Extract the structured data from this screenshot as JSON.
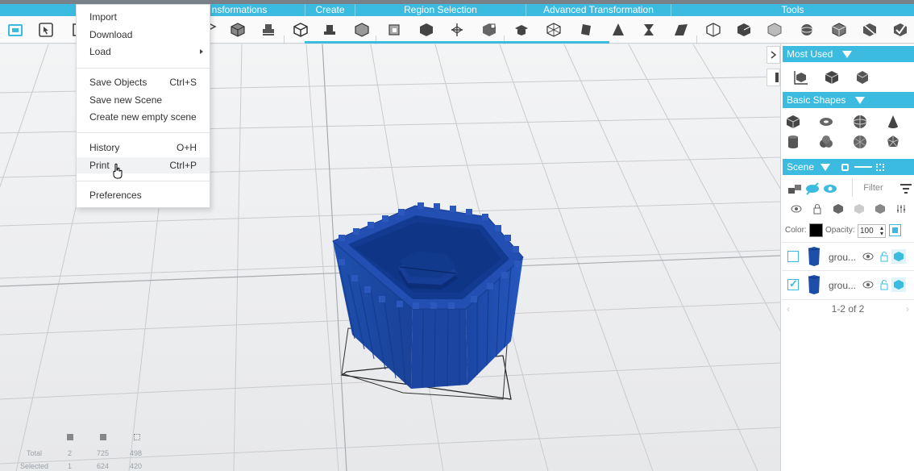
{
  "ribbon": {
    "categories": [
      {
        "label": "nsformations"
      },
      {
        "label": "Create"
      },
      {
        "label": "Region Selection"
      },
      {
        "label": "Advanced Transformation"
      },
      {
        "label": "Tools"
      }
    ]
  },
  "file_menu": {
    "items": [
      {
        "label": "Import",
        "shortcut": ""
      },
      {
        "label": "Download",
        "shortcut": ""
      },
      {
        "label": "Load",
        "shortcut": ""
      },
      {
        "label": "Save Objects",
        "shortcut": "Ctrl+S"
      },
      {
        "label": "Save new Scene",
        "shortcut": ""
      },
      {
        "label": "Create new empty scene",
        "shortcut": ""
      },
      {
        "label": "History",
        "shortcut": "O+H"
      },
      {
        "label": "Print",
        "shortcut": "Ctrl+P"
      },
      {
        "label": "Preferences",
        "shortcut": ""
      }
    ]
  },
  "right_panel": {
    "most_used_title": "Most Used",
    "basic_shapes_title": "Basic Shapes",
    "scene_title": "Scene",
    "filter_placeholder": "Filter",
    "color_label": "Color:",
    "opacity_label": "Opacity:",
    "opacity_value": "100",
    "color_value": "#000000",
    "objects": [
      {
        "name": "grou...",
        "checked": false
      },
      {
        "name": "grou...",
        "checked": true
      }
    ],
    "pager": "1-2 of 2"
  },
  "stats": {
    "total_label": "Total",
    "selected_label": "Selected",
    "total": [
      "2",
      "725",
      "498"
    ],
    "selected": [
      "1",
      "624",
      "420"
    ]
  },
  "colors": {
    "accent": "#3bbbe0",
    "model": "#1d4ea8"
  }
}
